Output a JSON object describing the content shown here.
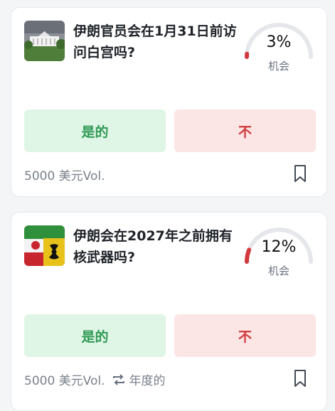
{
  "markets": [
    {
      "title": "伊朗官员会在1月31日前访问白宫吗?",
      "thumbnail": "white-house-photo",
      "chance_percent": 3,
      "chance_text": "3%",
      "chance_label": "机会",
      "yes_label": "是的",
      "no_label": "不",
      "volume": "5000 美元Vol.",
      "recurrence": ""
    },
    {
      "title": "伊朗会在2027年之前拥有核武器吗?",
      "thumbnail": "iran-flag-radiation-photo",
      "chance_percent": 12,
      "chance_text": "12%",
      "chance_label": "机会",
      "yes_label": "是的",
      "no_label": "不",
      "volume": "5000 美元Vol.",
      "recurrence": "年度的"
    }
  ],
  "colors": {
    "yes_bg": "#dff5e5",
    "yes_text": "#2f9a55",
    "no_bg": "#fbe5e5",
    "no_text": "#d2393e",
    "gauge_track": "#e5e7eb",
    "gauge_fill": "#d2393e"
  },
  "icons": {
    "bookmark": "bookmark-icon",
    "recurring": "repeat-icon"
  }
}
